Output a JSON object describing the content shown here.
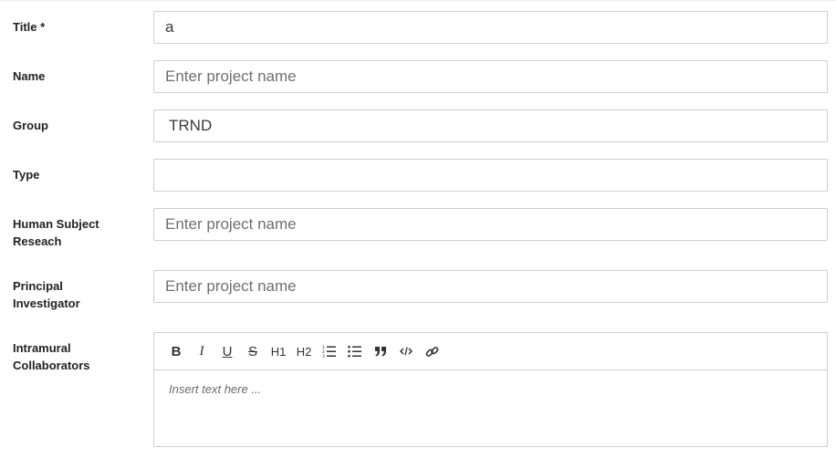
{
  "form": {
    "title": {
      "label": "Title *",
      "value": "a",
      "placeholder": ""
    },
    "name": {
      "label": "Name",
      "value": "",
      "placeholder": "Enter project name"
    },
    "group": {
      "label": "Group",
      "value": "TRND"
    },
    "type": {
      "label": "Type",
      "value": "",
      "placeholder": ""
    },
    "human_subject": {
      "label_line1": "Human Subject",
      "label_line2": "Reseach",
      "value": "",
      "placeholder": "Enter project name"
    },
    "principal_investigator": {
      "label_line1": "Principal",
      "label_line2": "Investigator",
      "value": "",
      "placeholder": "Enter project name"
    },
    "intramural": {
      "label_line1": "Intramural",
      "label_line2": "Collaborators",
      "editor_placeholder": "Insert text here ...",
      "toolbar": [
        {
          "name": "bold-icon",
          "glyph": "B"
        },
        {
          "name": "italic-icon",
          "glyph": "I"
        },
        {
          "name": "underline-icon",
          "glyph": "U"
        },
        {
          "name": "strikethrough-icon",
          "glyph": "S"
        },
        {
          "name": "heading-1-icon",
          "glyph": "H1"
        },
        {
          "name": "heading-2-icon",
          "glyph": "H2"
        },
        {
          "name": "ordered-list-icon",
          "glyph": ""
        },
        {
          "name": "bullet-list-icon",
          "glyph": ""
        },
        {
          "name": "blockquote-icon",
          "glyph": "”"
        },
        {
          "name": "code-icon",
          "glyph": "</>"
        },
        {
          "name": "link-icon",
          "glyph": ""
        }
      ]
    }
  },
  "colors": {
    "border": "#cfcfcf",
    "label": "#222222",
    "placeholder": "#707070",
    "text": "#3a3a3a"
  }
}
